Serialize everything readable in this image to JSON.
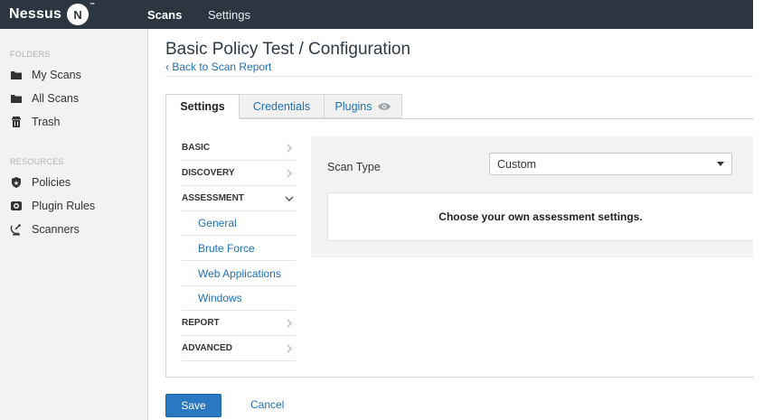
{
  "app": {
    "logo_text": "Nessus",
    "logo_badge": "N",
    "logo_tm": "™"
  },
  "topnav": {
    "scans": "Scans",
    "settings": "Settings"
  },
  "sidebar": {
    "folders_heading": "FOLDERS",
    "folders": [
      {
        "label": "My Scans",
        "icon": "folder-icon"
      },
      {
        "label": "All Scans",
        "icon": "folder-icon"
      },
      {
        "label": "Trash",
        "icon": "trash-icon"
      }
    ],
    "resources_heading": "RESOURCES",
    "resources": [
      {
        "label": "Policies",
        "icon": "policy-icon"
      },
      {
        "label": "Plugin Rules",
        "icon": "plugin-rules-icon"
      },
      {
        "label": "Scanners",
        "icon": "scanner-icon"
      }
    ]
  },
  "header": {
    "title": "Basic Policy Test / Configuration",
    "back_link": "‹ Back to Scan Report"
  },
  "tabs": {
    "settings": "Settings",
    "credentials": "Credentials",
    "plugins": "Plugins"
  },
  "menu": {
    "sections": [
      {
        "label": "BASIC",
        "state": "collapsed"
      },
      {
        "label": "DISCOVERY",
        "state": "collapsed"
      },
      {
        "label": "ASSESSMENT",
        "state": "expanded"
      }
    ],
    "assessment_items": [
      "General",
      "Brute Force",
      "Web Applications",
      "Windows"
    ],
    "after_sections": [
      {
        "label": "REPORT",
        "state": "collapsed"
      },
      {
        "label": "ADVANCED",
        "state": "collapsed"
      }
    ]
  },
  "content": {
    "scan_type_label": "Scan Type",
    "scan_type_value": "Custom",
    "description": "Choose your own assessment settings."
  },
  "actions": {
    "save": "Save",
    "cancel": "Cancel"
  },
  "colors": {
    "topbar": "#2b3640",
    "link": "#1e6fb8",
    "primary_button": "#2b78c2"
  }
}
